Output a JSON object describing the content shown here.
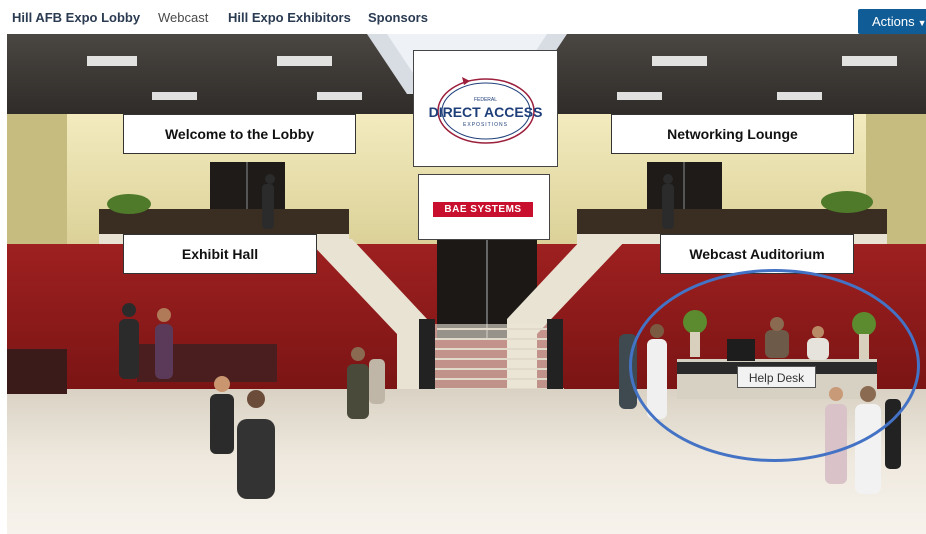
{
  "nav": {
    "items": [
      {
        "label": "Hill AFB Expo Lobby",
        "style": "bold"
      },
      {
        "label": "Webcast",
        "style": "plain"
      },
      {
        "label": "Hill Expo Exhibitors",
        "style": "bold"
      },
      {
        "label": "Sponsors",
        "style": "bold"
      }
    ],
    "actions_label": "Actions"
  },
  "lobby": {
    "signs": {
      "welcome": "Welcome to the Lobby",
      "networking": "Networking Lounge",
      "exhibit": "Exhibit Hall",
      "webcast": "Webcast Auditorium"
    },
    "sponsor_logo": {
      "top_text": "FEDERAL",
      "main_text": "DIRECT ACCESS",
      "sub_text": "EXPOSITIONS"
    },
    "bae_logo": "BAE SYSTEMS",
    "help_desk_tooltip": "Help Desk"
  },
  "colors": {
    "accent": "#0f5c96",
    "highlight_ring": "#4472c4",
    "wall_red": "#8f1b1b",
    "bae_red": "#c8102e"
  }
}
